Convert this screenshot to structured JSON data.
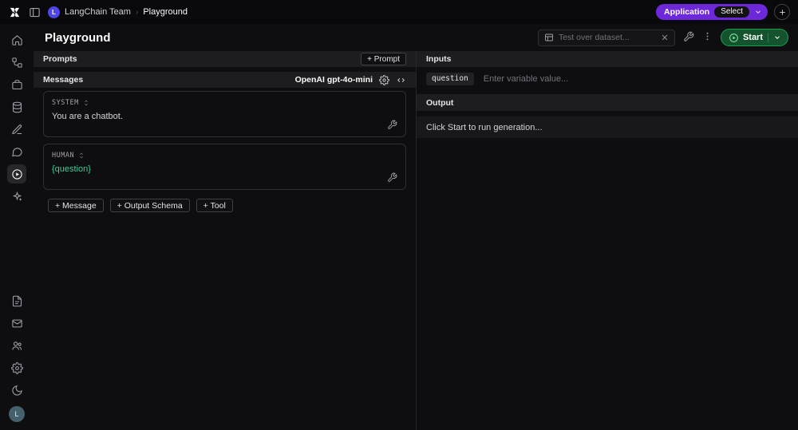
{
  "header": {
    "org_initial": "L",
    "org_name": "LangChain Team",
    "breadcrumb_separator": "›",
    "breadcrumb_page": "Playground",
    "application_label": "Application",
    "select_label": "Select",
    "plus_label": "+"
  },
  "sidebar": {
    "items": [
      "home",
      "workflows",
      "projects",
      "datasets",
      "annotations",
      "monitoring",
      "playground",
      "integrations"
    ],
    "active_item": "playground",
    "bottom_items": [
      "docs",
      "mail",
      "members",
      "settings",
      "dark-mode"
    ],
    "avatar_initial": "L"
  },
  "page": {
    "title": "Playground",
    "dataset_search_placeholder": "Test over dataset...",
    "start_button_label": "Start"
  },
  "prompts_panel": {
    "header": "Prompts",
    "add_prompt_label": "+ Prompt",
    "messages_header": "Messages",
    "model_label": "OpenAI gpt-4o-mini",
    "messages": [
      {
        "role": "SYSTEM",
        "content": "You are a chatbot."
      },
      {
        "role": "HUMAN",
        "content": "{question}"
      }
    ],
    "add_message_label": "+ Message",
    "add_output_schema_label": "+ Output Schema",
    "add_tool_label": "+ Tool"
  },
  "io_panel": {
    "inputs_header": "Inputs",
    "input_key": "question",
    "input_placeholder": "Enter variable value...",
    "output_header": "Output",
    "output_placeholder": "Click Start to run generation..."
  },
  "colors": {
    "accent_purple": "#6d28d9",
    "accent_green": "#16a34a",
    "variable_teal": "#34d399",
    "panel_bar": "#1d1d20",
    "background": "#0e0e10"
  }
}
